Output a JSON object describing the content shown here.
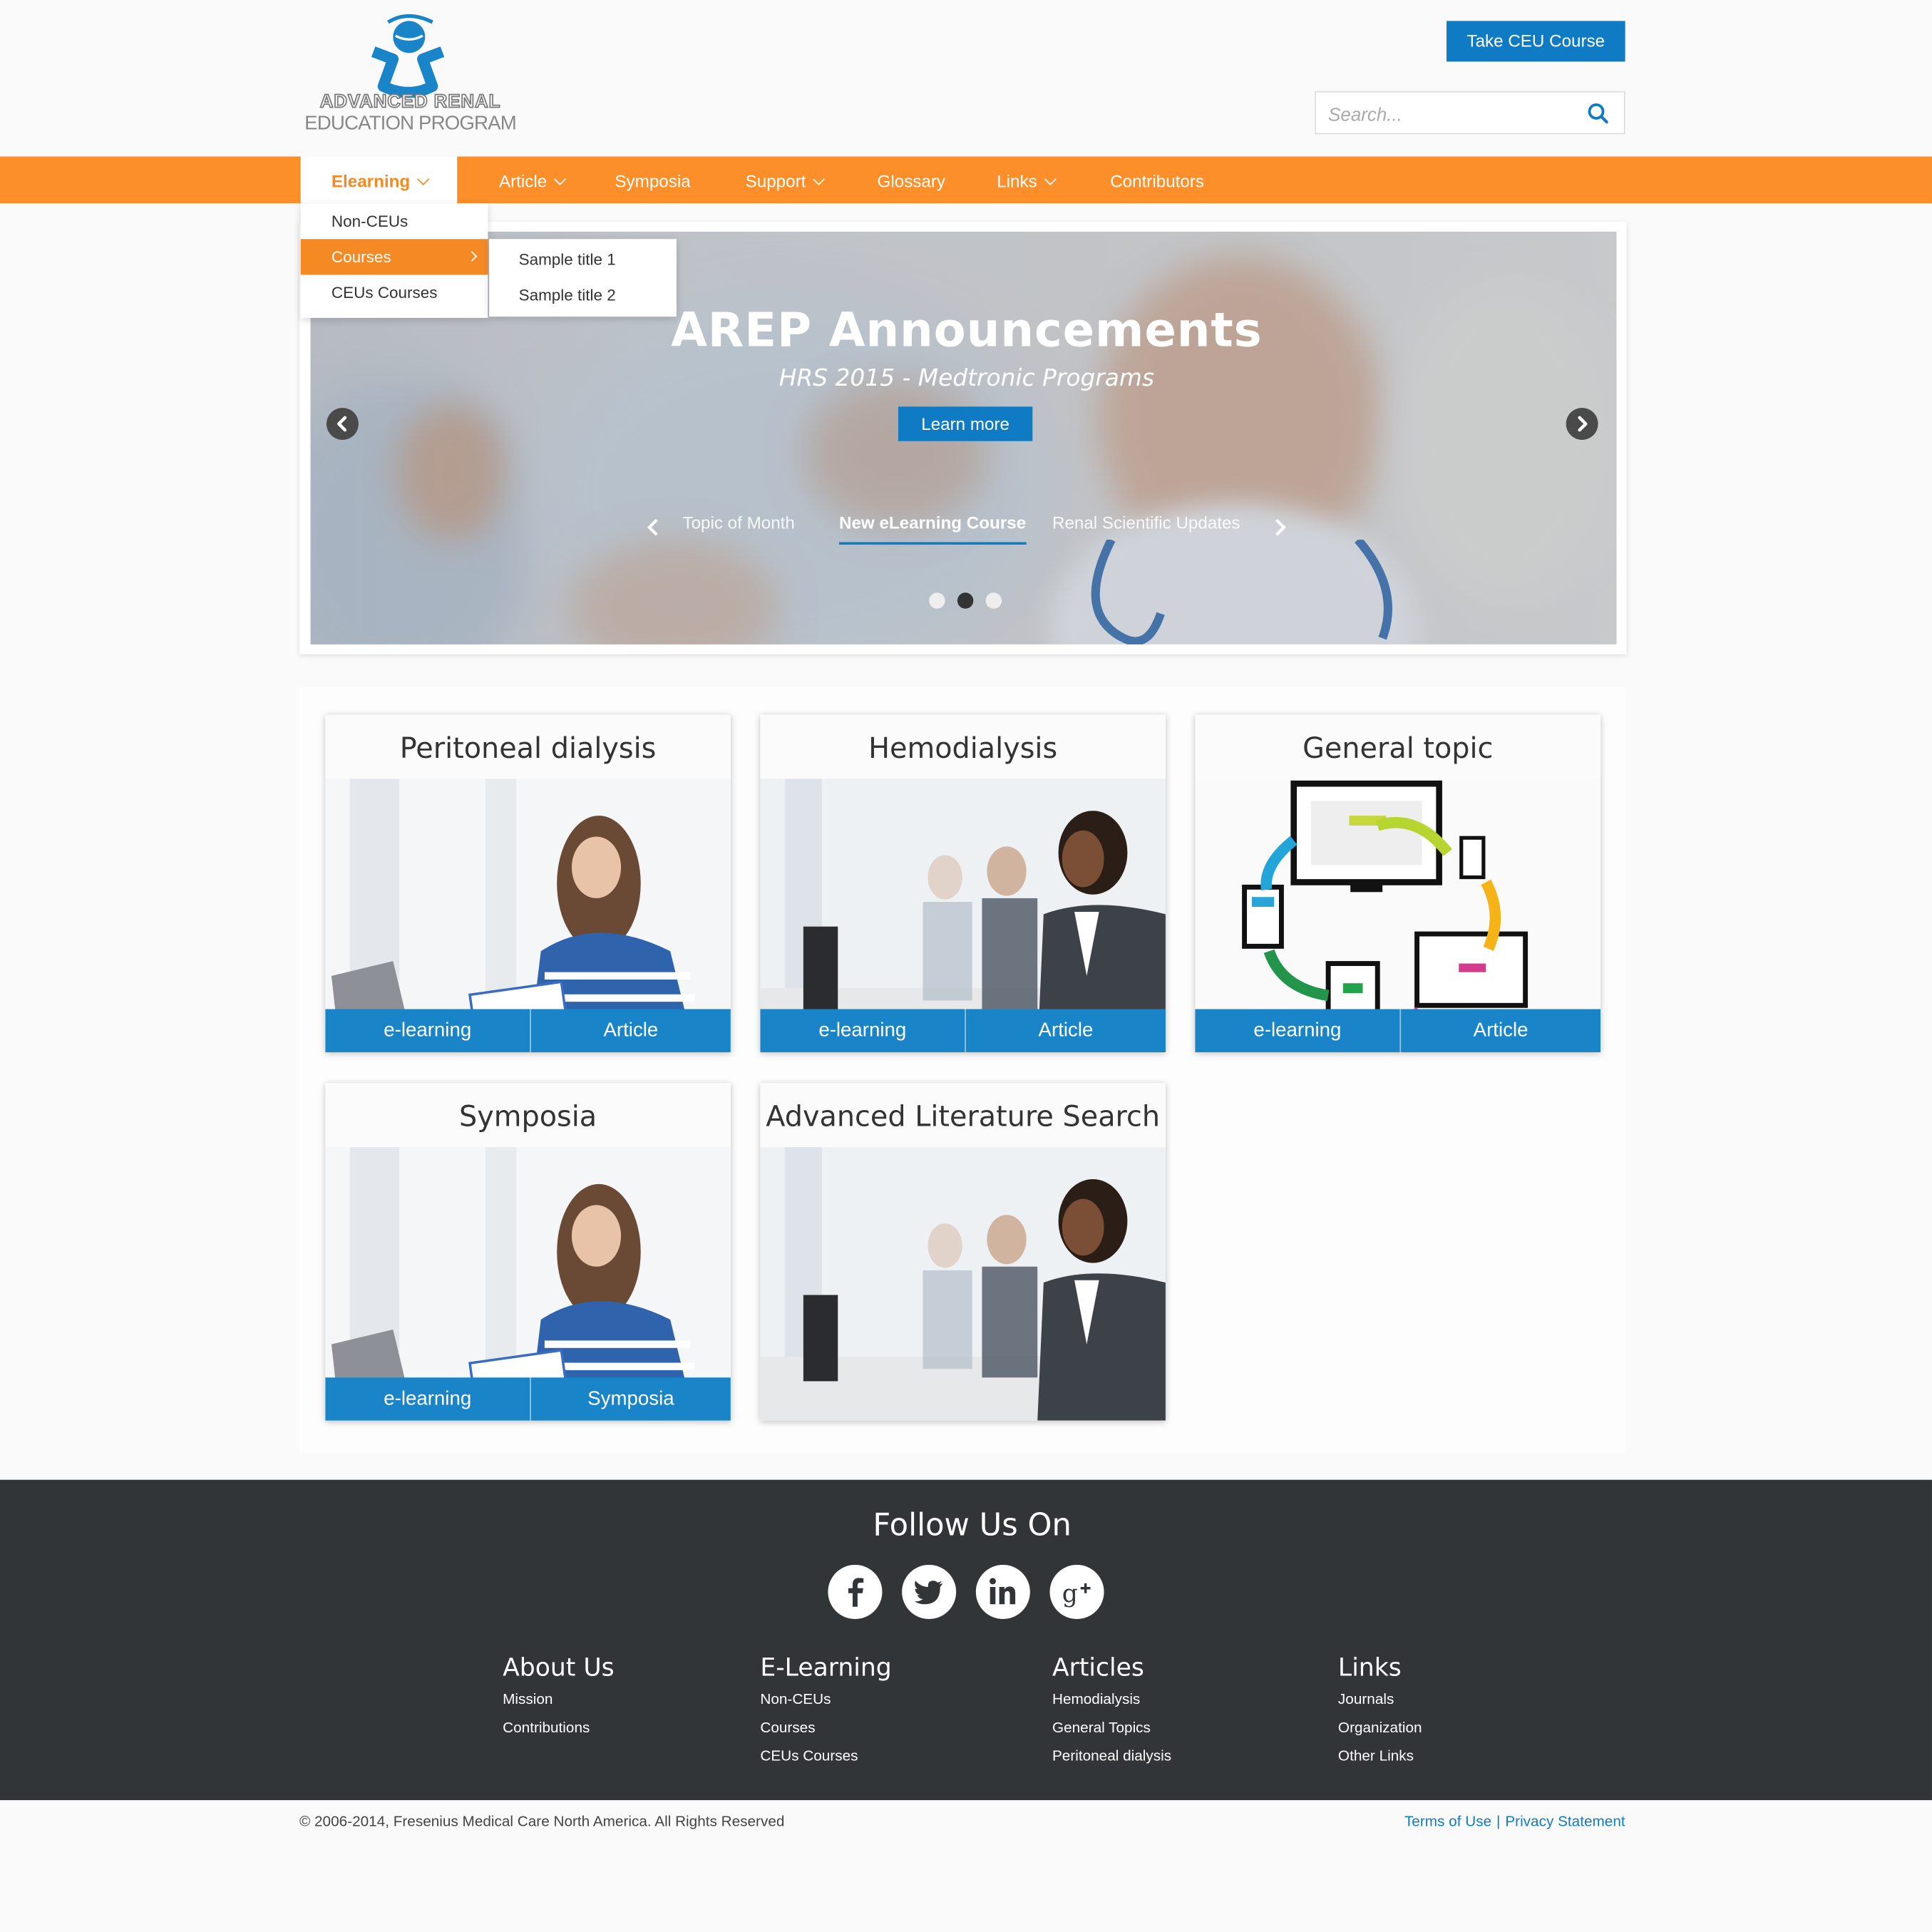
{
  "header": {
    "logo_line1": "ADVANCED RENAL",
    "logo_line2": "EDUCATION PROGRAM",
    "ceu_button": "Take CEU Course",
    "search_placeholder": "Search..."
  },
  "nav": {
    "items": [
      {
        "label": "Elearning",
        "has_dropdown": true,
        "active": true
      },
      {
        "label": "Article",
        "has_dropdown": true
      },
      {
        "label": "Symposia",
        "has_dropdown": false
      },
      {
        "label": "Support",
        "has_dropdown": true
      },
      {
        "label": "Glossary",
        "has_dropdown": false
      },
      {
        "label": "Links",
        "has_dropdown": true
      },
      {
        "label": "Contributors",
        "has_dropdown": false
      }
    ],
    "dropdown": [
      "Non-CEUs",
      "Courses",
      "CEUs Courses"
    ],
    "dropdown_active": "Courses",
    "subdropdown": [
      "Sample title 1",
      "Sample title 2"
    ]
  },
  "hero": {
    "title": "AREP Announcements",
    "subtitle": "HRS 2015 - Medtronic Programs",
    "button": "Learn more",
    "tabs": [
      {
        "label": "Topic of Month",
        "active": false
      },
      {
        "label": "New eLearning Course",
        "active": true
      },
      {
        "label": "Renal Scientific Updates",
        "active": false
      }
    ],
    "dots_count": 3,
    "active_dot": 2
  },
  "cards": [
    {
      "title": "Peritoneal dialysis",
      "image": "student-laptop",
      "buttons": [
        "e-learning",
        "Article"
      ]
    },
    {
      "title": "Hemodialysis",
      "image": "business-people",
      "buttons": [
        "e-learning",
        "Article"
      ]
    },
    {
      "title": "General topic",
      "image": "responsive-devices",
      "buttons": [
        "e-learning",
        "Article"
      ]
    },
    {
      "title": "Symposia",
      "image": "student-laptop",
      "buttons": [
        "e-learning",
        "Symposia"
      ]
    },
    {
      "title": "Advanced Literature Search",
      "image": "business-people",
      "buttons": []
    }
  ],
  "footer": {
    "follow_title": "Follow Us On",
    "social": [
      "facebook-icon",
      "twitter-icon",
      "linkedin-icon",
      "google-plus-icon"
    ],
    "columns": [
      {
        "title": "About Us",
        "links": [
          "Mission",
          "Contributions"
        ]
      },
      {
        "title": "E-Learning",
        "links": [
          "Non-CEUs",
          "Courses",
          "CEUs Courses"
        ]
      },
      {
        "title": "Articles",
        "links": [
          "Hemodialysis",
          "General Topics",
          "Peritoneal dialysis"
        ]
      },
      {
        "title": "Links",
        "links": [
          "Journals",
          "Organization",
          "Other Links"
        ]
      }
    ],
    "copyright": "© 2006-2014, Fresenius Medical Care North America. All Rights Reserved",
    "terms": "Terms of Use",
    "privacy": "Privacy Statement",
    "separator": "|"
  },
  "colors": {
    "brand_orange": "#fc8f2a",
    "brand_blue": "#0f7bc4",
    "footer_bg": "#323538"
  }
}
